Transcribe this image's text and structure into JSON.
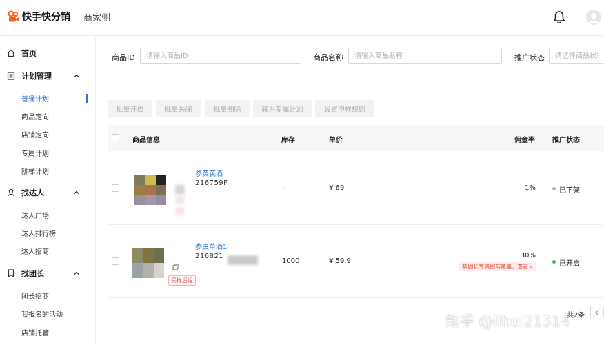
{
  "header": {
    "brand": "快手快分销",
    "subtitle": "商家侧",
    "bell_icon": "bell-icon",
    "avatar_icon": "user-avatar-icon"
  },
  "sidebar": {
    "home": "首页",
    "plan_group": "计划管理",
    "plan_items": [
      "普通计划",
      "商品定向",
      "店铺定向",
      "专属计划",
      "阶梯计划"
    ],
    "influencer_group": "找达人",
    "influencer_items": [
      "达人广场",
      "达人排行榜",
      "达人招商"
    ],
    "leader_group": "找团长",
    "leader_items": [
      "团长招商",
      "我报名的活动",
      "店铺托管"
    ]
  },
  "filters": {
    "product_id_label": "商品ID",
    "product_id_placeholder": "请输入商品ID",
    "product_name_label": "商品名称",
    "product_name_placeholder": "请输入商品名称",
    "status_label": "推广状态",
    "status_placeholder": "请选择商品状态"
  },
  "actions": {
    "batch_open": "批量开启",
    "batch_close": "批量关闭",
    "batch_delete": "批量删除",
    "to_exclusive": "转为专属计划",
    "sample_rule": "设置申样规则"
  },
  "table": {
    "columns": {
      "info": "商品信息",
      "stock": "库存",
      "price": "单价",
      "commission": "佣金率",
      "status": "推广状态"
    },
    "rows": [
      {
        "name": "参黄芪酒",
        "id": "216759F",
        "stock": ".",
        "price": "¥ 69",
        "commission": "1%",
        "status": "已下架",
        "status_color": "#b3b3b3"
      },
      {
        "name": "参虫草酒1",
        "id": "216821",
        "tag": "买样后返",
        "stock": "1000",
        "price": "¥ 59.9",
        "commission": "30%",
        "note": "被团长专属招商覆盖，查看>",
        "status": "已开启",
        "status_color": "#3bb54a"
      }
    ]
  },
  "pagination": {
    "total": "共2条"
  },
  "watermark": "知乎 @lihui21314",
  "colors": {
    "accent": "#2f6fd6",
    "brand": "#ff5a1f"
  }
}
